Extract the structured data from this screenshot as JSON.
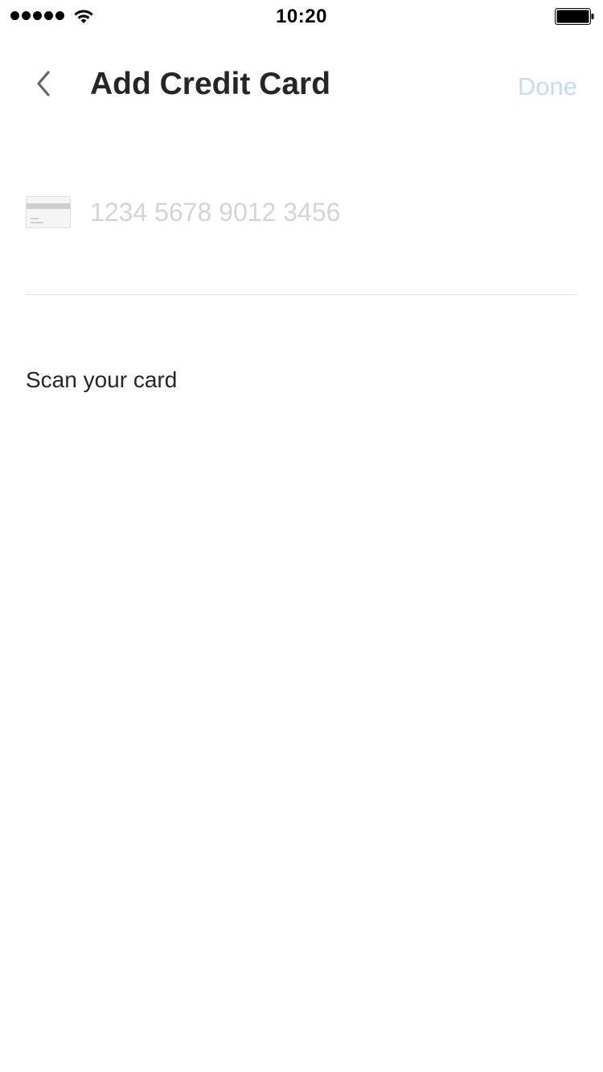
{
  "status_bar": {
    "time": "10:20",
    "signal_icon": "signal-dots-icon",
    "wifi_icon": "wifi-icon",
    "battery_icon": "battery-icon"
  },
  "nav": {
    "back_icon": "chevron-left-icon",
    "title": "Add Credit Card",
    "done_label": "Done"
  },
  "card_form": {
    "card_icon": "credit-card-icon",
    "number_placeholder": "1234 5678 9012 3456",
    "number_value": ""
  },
  "scan": {
    "label": "Scan your card"
  },
  "colors": {
    "title_text": "#262626",
    "done_disabled": "#c6dcf4",
    "placeholder": "#d4d4d4",
    "divider": "#e6e6e6"
  }
}
